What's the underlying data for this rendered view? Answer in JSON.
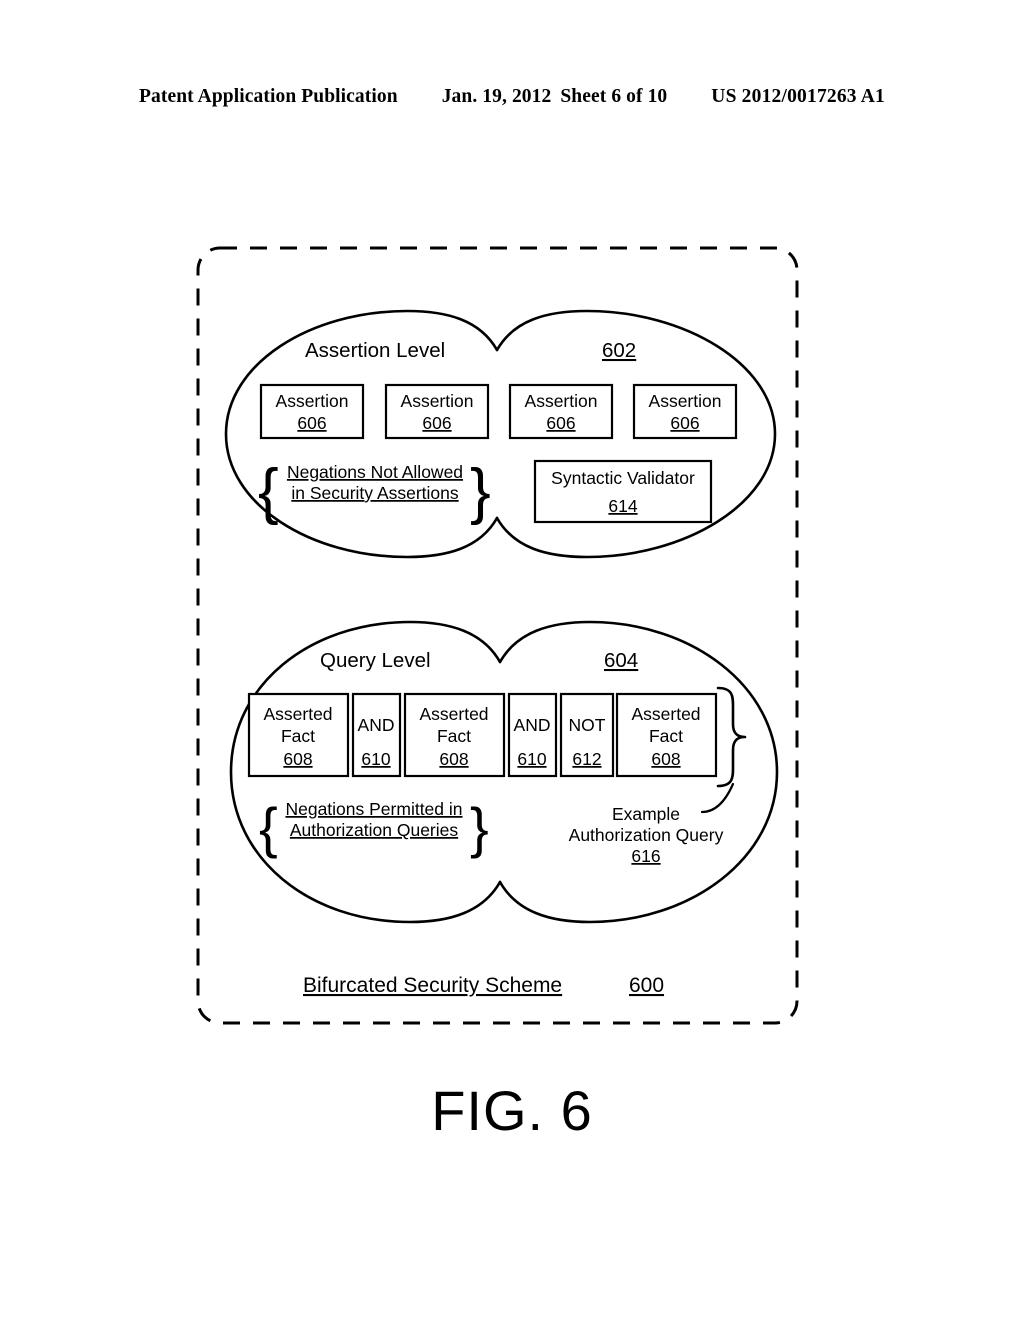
{
  "header": {
    "publication": "Patent Application Publication",
    "date": "Jan. 19, 2012",
    "sheet": "Sheet 6 of 10",
    "number": "US 2012/0017263 A1"
  },
  "figure": {
    "caption": "FIG. 6",
    "scheme_title": "Bifurcated Security Scheme",
    "scheme_ref": "600"
  },
  "assertion_level": {
    "label": "Assertion Level",
    "ref": "602",
    "assertions": [
      {
        "label": "Assertion",
        "ref": "606"
      },
      {
        "label": "Assertion",
        "ref": "606"
      },
      {
        "label": "Assertion",
        "ref": "606"
      },
      {
        "label": "Assertion",
        "ref": "606"
      }
    ],
    "note_line1": "Negations Not Allowed",
    "note_line2": "in Security Assertions",
    "validator": {
      "label": "Syntactic Validator",
      "ref": "614"
    },
    "brace_open": "{",
    "brace_close": "}"
  },
  "query_level": {
    "label": "Query Level",
    "ref": "604",
    "query_terms": [
      {
        "line1": "Asserted",
        "line2": "Fact",
        "ref": "608",
        "kind": "fact"
      },
      {
        "line1": "AND",
        "line2": "",
        "ref": "610",
        "kind": "operator"
      },
      {
        "line1": "Asserted",
        "line2": "Fact",
        "ref": "608",
        "kind": "fact"
      },
      {
        "line1": "AND",
        "line2": "",
        "ref": "610",
        "kind": "operator"
      },
      {
        "line1": "NOT",
        "line2": "",
        "ref": "612",
        "kind": "operator"
      },
      {
        "line1": "Asserted",
        "line2": "Fact",
        "ref": "608",
        "kind": "fact"
      }
    ],
    "note_line1": "Negations Permitted in",
    "note_line2": "Authorization Queries",
    "example_caption_line1": "Example",
    "example_caption_line2": "Authorization Query",
    "example_ref": "616",
    "brace_open": "{",
    "brace_close": "}",
    "brace_example": "}"
  },
  "colors": {
    "ink": "#000000",
    "paper": "#ffffff"
  }
}
